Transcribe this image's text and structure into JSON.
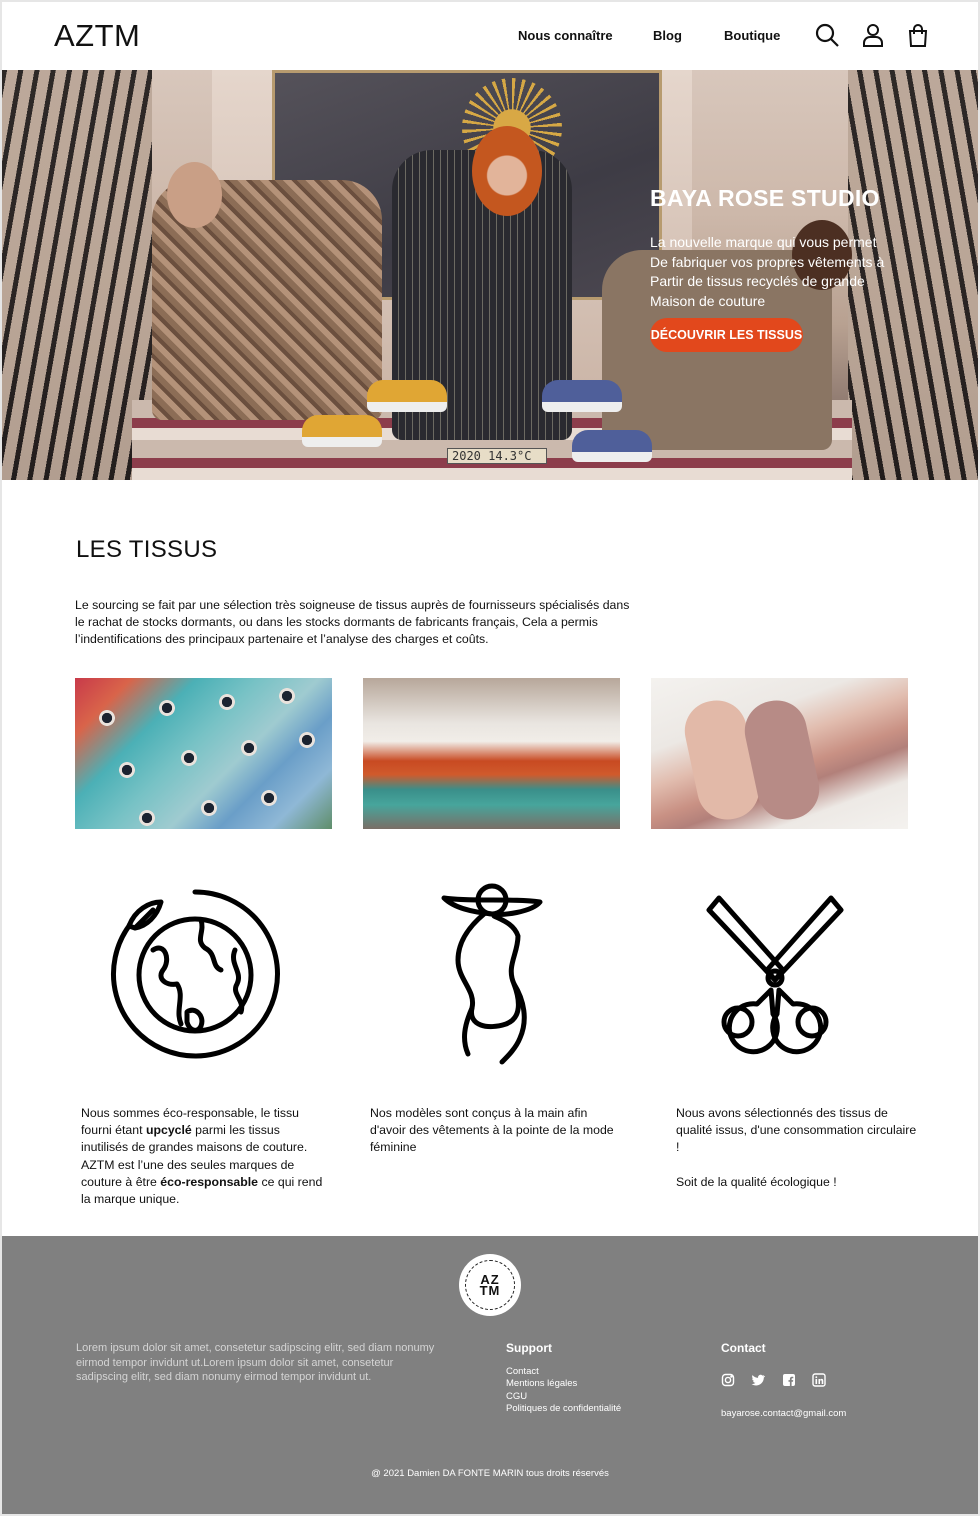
{
  "header": {
    "logo": "AZTM",
    "nav": [
      "Nous connaître",
      "Blog",
      "Boutique"
    ],
    "icons": [
      "search-icon",
      "user-icon",
      "shopping-bag-icon"
    ]
  },
  "hero": {
    "title": "BAYA ROSE STUDIO",
    "text_lines": [
      "La nouvelle marque qui vous permet",
      "De fabriquer vos propres vêtements à",
      "Partir de tissus recyclés de grande",
      "Maison de couture"
    ],
    "button": "DÉCOUVRIR LES TISSUS",
    "photo_sign": "2020  14.3°C",
    "accent": "#e2481c"
  },
  "tissus": {
    "title": "LES TISSUS",
    "intro_lines": [
      "Le sourcing se fait par une sélection très soigneuse de tissus auprès de fournisseurs spécialisés dans",
      "le rachat de stocks dormants, ou dans les stocks dormants de fabricants français, Cela a permis",
      "l’indentifications des principaux partenaire et l’analyse des charges et coûts."
    ],
    "photos": [
      "spools-of-thread-photo",
      "fabric-cutting-table-photo",
      "rolled-fabrics-photo"
    ],
    "feature_icons": [
      "eco-earth-icon",
      "fashion-figure-icon",
      "scissors-icon"
    ],
    "features": [
      {
        "lines": [
          [
            "Nous sommes éco-responsable, le tissu"
          ],
          [
            "fourni étant ",
            "upcyclé",
            " parmi les tissus"
          ],
          [
            "inutilisés de grandes maisons de couture."
          ],
          [
            "AZTM est l’une des seules marques de"
          ],
          [
            "couture à être ",
            "éco-responsable",
            " ce qui rend"
          ],
          [
            "la marque unique."
          ]
        ]
      },
      {
        "lines": [
          [
            "Nos modèles sont conçus à la main afin"
          ],
          [
            "d'avoir des vêtements à la pointe de la mode"
          ],
          [
            "féminine"
          ]
        ]
      },
      {
        "lines": [
          [
            "Nous avons sélectionnés  des tissus de"
          ],
          [
            "qualité issus, d'une consommation circulaire"
          ],
          [
            "!"
          ],
          [
            ""
          ],
          [
            "Soit de la qualité écologique !"
          ]
        ]
      }
    ]
  },
  "footer": {
    "logo_top": "AZ",
    "logo_bottom": "TM",
    "lorem_lines": [
      "Lorem ipsum dolor sit amet, consetetur sadipscing elitr, sed diam nonumy",
      "eirmod tempor invidunt ut.Lorem ipsum dolor sit amet, consetetur",
      "sadipscing elitr, sed diam nonumy eirmod tempor invidunt ut."
    ],
    "support_title": "Support",
    "support_links": [
      "Contact",
      "Mentions légales",
      "CGU",
      "Politiques de confidentialité"
    ],
    "contact_title": "Contact",
    "social_icons": [
      "instagram-icon",
      "twitter-icon",
      "facebook-icon",
      "linkedin-icon"
    ],
    "email": "bayarose.contact@gmail.com",
    "copyright": "@ 2021 Damien DA FONTE MARIN tous droits réservés",
    "background": "#808080"
  }
}
